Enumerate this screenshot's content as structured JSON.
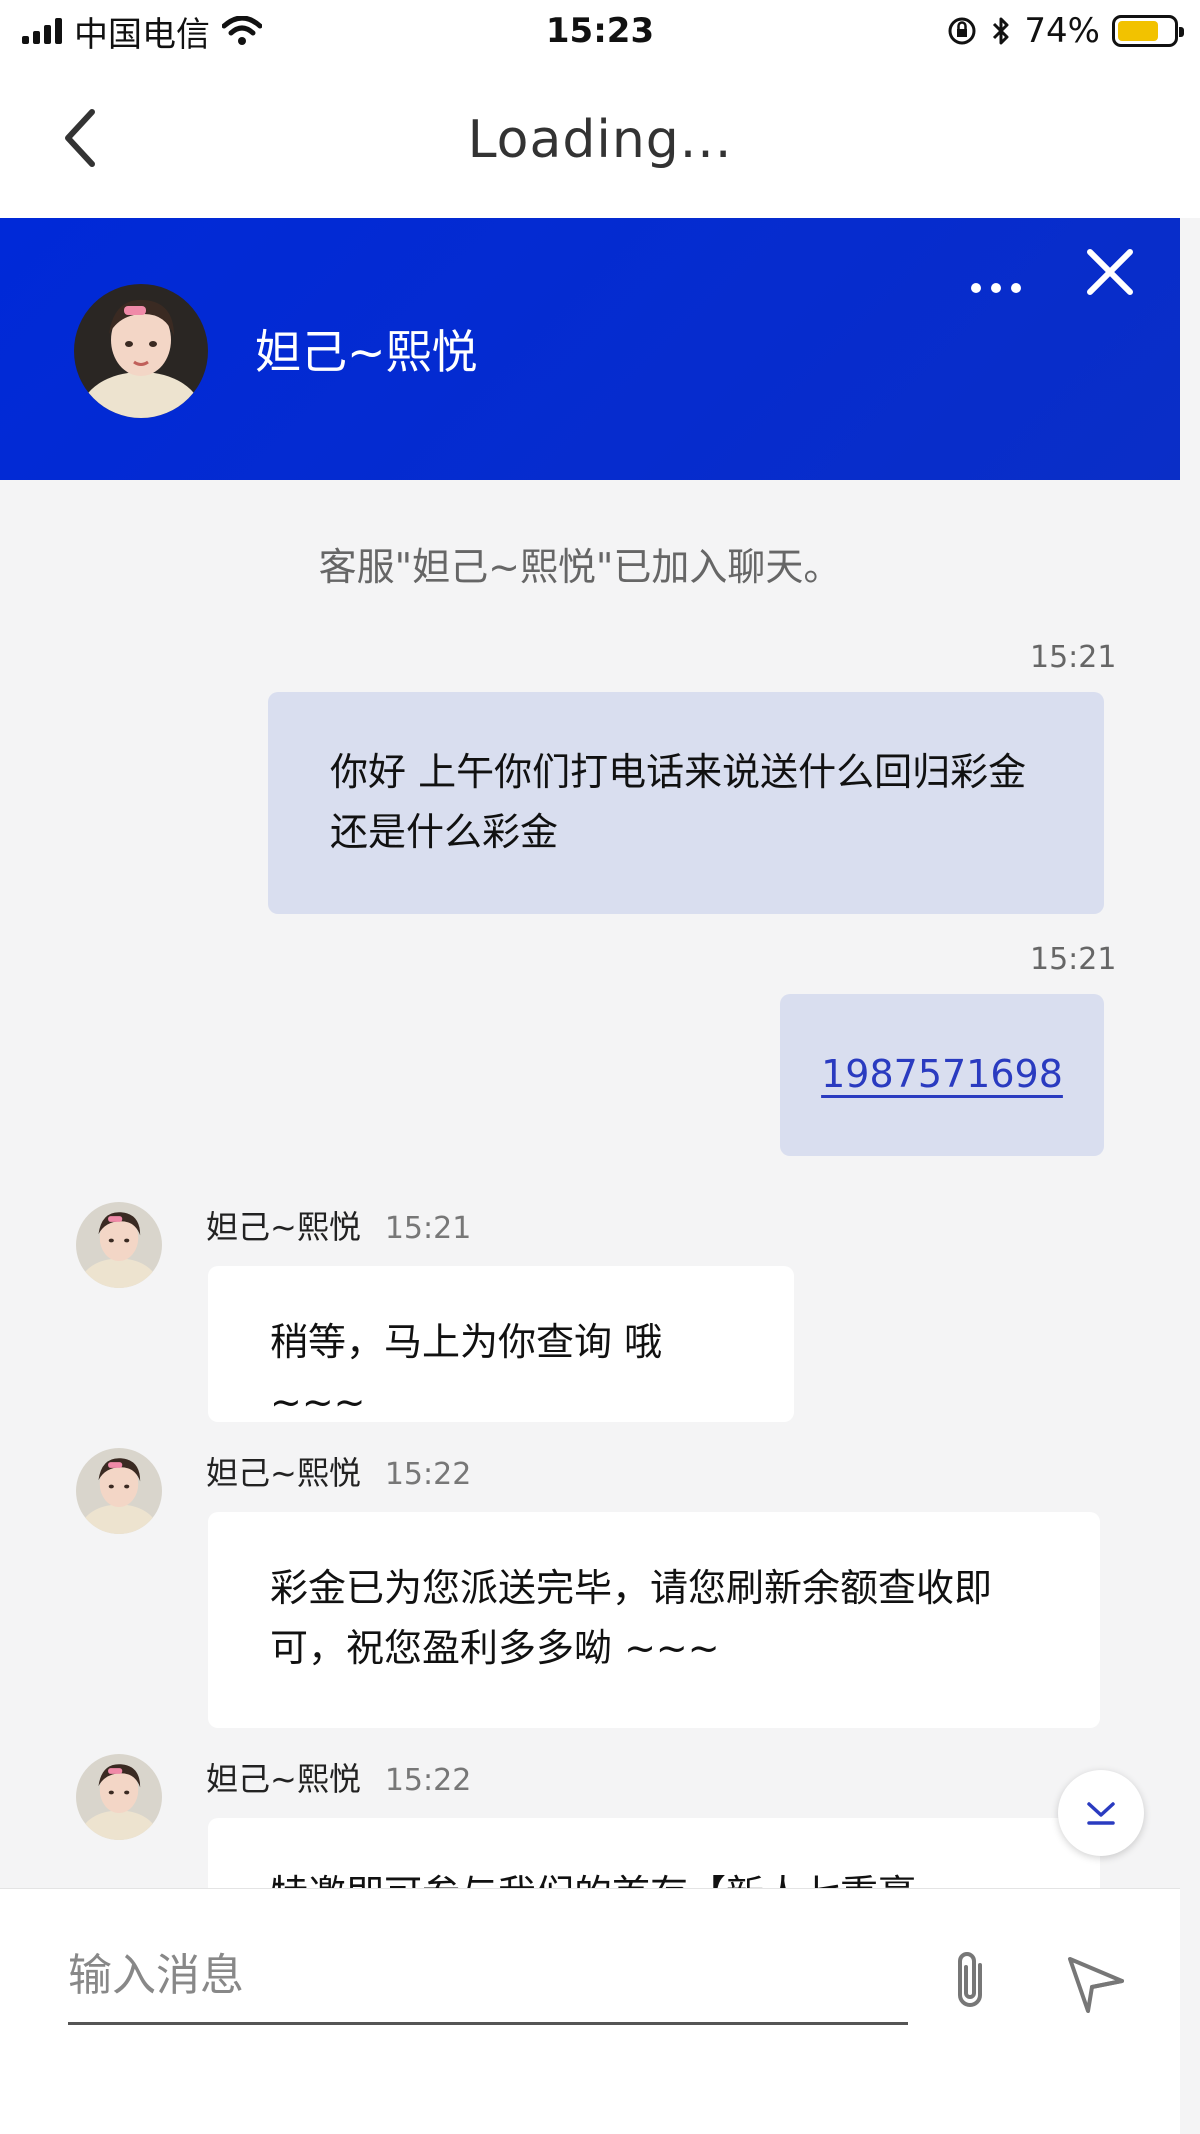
{
  "status_bar": {
    "carrier": "中国电信",
    "time": "15:23",
    "battery_percent": "74%",
    "battery_level": 0.74,
    "icons": [
      "signal-icon",
      "wifi-icon",
      "orientation-lock-icon",
      "bluetooth-icon",
      "battery-icon"
    ]
  },
  "nav": {
    "title": "Loading..."
  },
  "header": {
    "agent_name": "妲己~熙悦",
    "accent_color": "#0029d8"
  },
  "messages": {
    "system_note": "客服\"妲己~熙悦\"已加入聊天。",
    "items": [
      {
        "direction": "out",
        "time": "15:21",
        "text": "你好 上午你们打电话来说送什么回归彩金还是什么彩金"
      },
      {
        "direction": "out",
        "time": "15:21",
        "text": "1987571698"
      },
      {
        "direction": "in",
        "sender": "妲己~熙悦",
        "time": "15:21",
        "text": "稍等，马上为你查询 哦~~~"
      },
      {
        "direction": "in",
        "sender": "妲己~熙悦",
        "time": "15:22",
        "text": "彩金已为您派送完毕，请您刷新余额查收即可，祝您盈利多多呦 ~~~"
      },
      {
        "direction": "in",
        "sender": "妲己~熙悦",
        "time": "15:22",
        "text": "特邀即可参与我们的首存【新人七重豪"
      }
    ]
  },
  "input": {
    "placeholder": "输入消息",
    "value": ""
  }
}
